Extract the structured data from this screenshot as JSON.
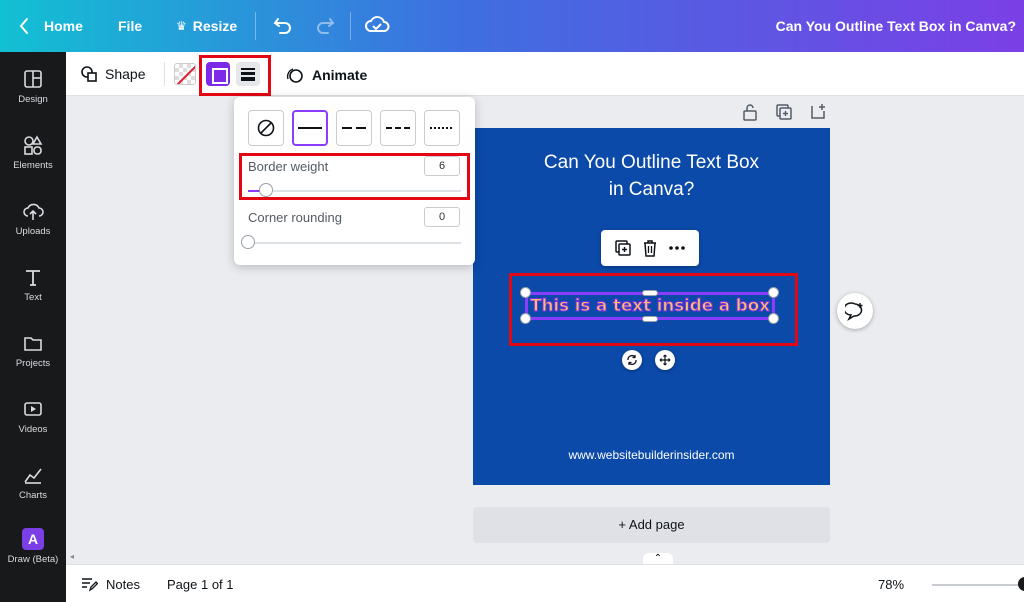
{
  "topbar": {
    "home_label": "Home",
    "file_label": "File",
    "resize_label": "Resize",
    "doc_title": "Can You Outline Text Box in Canva?"
  },
  "sidebar": {
    "items": [
      {
        "label": "Design",
        "icon": "design-icon"
      },
      {
        "label": "Elements",
        "icon": "elements-icon"
      },
      {
        "label": "Uploads",
        "icon": "uploads-icon"
      },
      {
        "label": "Text",
        "icon": "text-icon"
      },
      {
        "label": "Projects",
        "icon": "projects-icon"
      },
      {
        "label": "Videos",
        "icon": "videos-icon"
      },
      {
        "label": "Charts",
        "icon": "charts-icon"
      },
      {
        "label": "Draw (Beta)",
        "icon": "draw-icon"
      }
    ]
  },
  "toolbar": {
    "shape_label": "Shape",
    "animate_label": "Animate"
  },
  "border_popup": {
    "weight_label": "Border weight",
    "weight_value": "6",
    "weight_fraction": 0.06,
    "rounding_label": "Corner rounding",
    "rounding_value": "0",
    "rounding_fraction": 0
  },
  "page": {
    "title_line1": "Can You Outline Text Box",
    "title_line2": "in Canva?",
    "text_box": "This is a text inside a box",
    "url": "www.websitebuilderinsider.com",
    "background": "#0b4aa8"
  },
  "canvas": {
    "add_page_label": "+ Add page"
  },
  "footer": {
    "notes_label": "Notes",
    "page_label": "Page 1 of 1",
    "zoom_label": "78%"
  },
  "colors": {
    "accent": "#8b3dff",
    "highlight": "#e30613",
    "text_fill": "#f5c26b"
  }
}
